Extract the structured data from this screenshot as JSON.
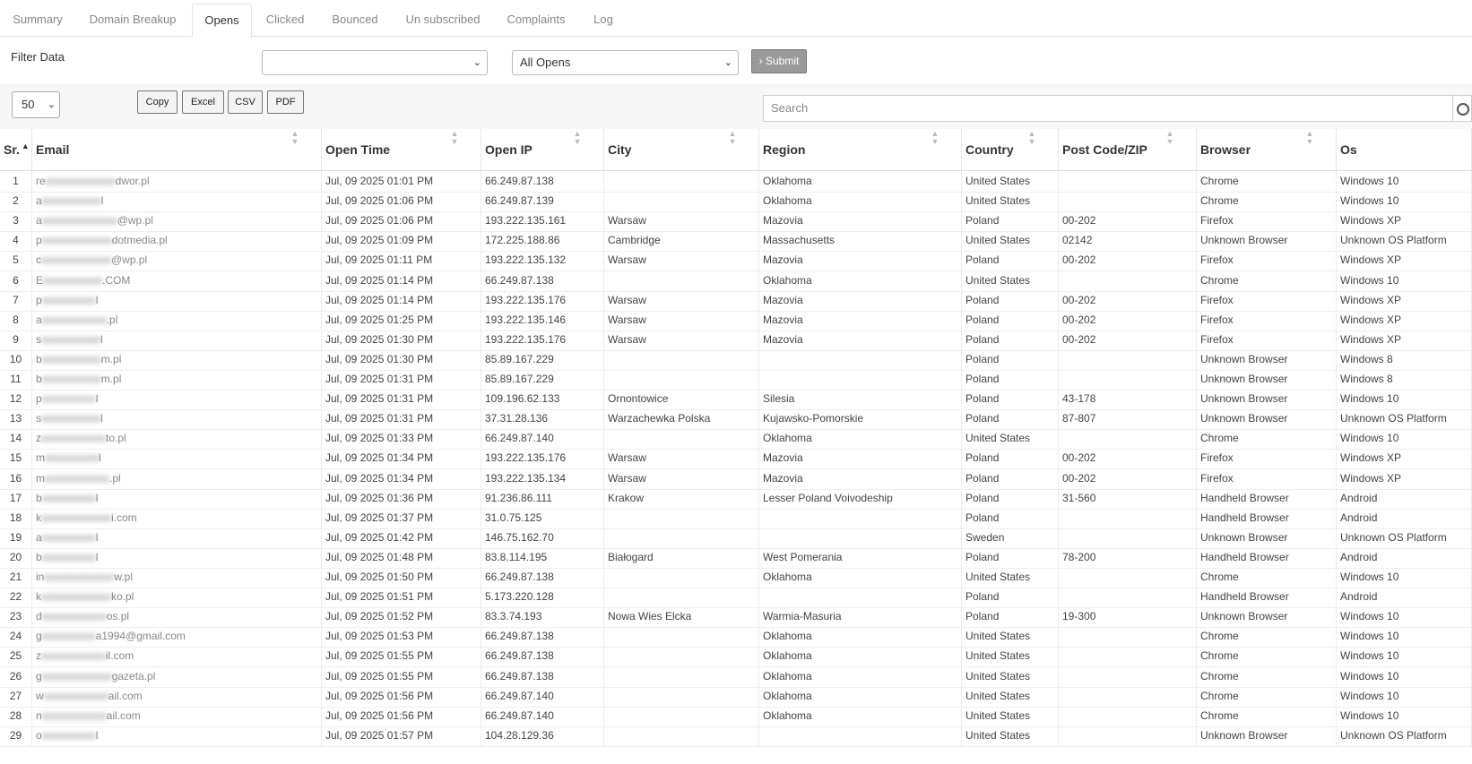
{
  "tabs": [
    {
      "label": "Summary",
      "active": false
    },
    {
      "label": "Domain Breakup",
      "active": false
    },
    {
      "label": "Opens",
      "active": true
    },
    {
      "label": "Clicked",
      "active": false
    },
    {
      "label": "Bounced",
      "active": false
    },
    {
      "label": "Un subscribed",
      "active": false
    },
    {
      "label": "Complaints",
      "active": false
    },
    {
      "label": "Log",
      "active": false
    }
  ],
  "filter": {
    "label": "Filter Data",
    "select1_value": "",
    "select2_value": "All Opens",
    "submit_label": "› Submit"
  },
  "controls": {
    "page_size": "50",
    "buttons": [
      "Copy",
      "Excel",
      "CSV",
      "PDF"
    ],
    "search_placeholder": "Search"
  },
  "columns": [
    "Sr.",
    "Email",
    "Open Time",
    "Open IP",
    "City",
    "Region",
    "Country",
    "Post Code/ZIP",
    "Browser",
    "Os"
  ],
  "rows": [
    [
      "1",
      "re■■■■■■■■■■■■■dwor.pl",
      "Jul, 09 2025 01:01 PM",
      "66.249.87.138",
      "",
      "Oklahoma",
      "United States",
      "",
      "Chrome",
      "Windows 10"
    ],
    [
      "2",
      "a■■■■■■■■■■■l",
      "Jul, 09 2025 01:06 PM",
      "66.249.87.139",
      "",
      "Oklahoma",
      "United States",
      "",
      "Chrome",
      "Windows 10"
    ],
    [
      "3",
      "a■■■■■■■■■■■■■■@wp.pl",
      "Jul, 09 2025 01:06 PM",
      "193.222.135.161",
      "Warsaw",
      "Mazovia",
      "Poland",
      "00-202",
      "Firefox",
      "Windows XP"
    ],
    [
      "4",
      "p■■■■■■■■■■■■■dotmedia.pl",
      "Jul, 09 2025 01:09 PM",
      "172.225.188.86",
      "Cambridge",
      "Massachusetts",
      "United States",
      "02142",
      "Unknown Browser",
      "Unknown OS Platform"
    ],
    [
      "5",
      "c■■■■■■■■■■■■■@wp.pl",
      "Jul, 09 2025 01:11 PM",
      "193.222.135.132",
      "Warsaw",
      "Mazovia",
      "Poland",
      "00-202",
      "Firefox",
      "Windows XP"
    ],
    [
      "6",
      "E■■■■■■■■■■■.COM",
      "Jul, 09 2025 01:14 PM",
      "66.249.87.138",
      "",
      "Oklahoma",
      "United States",
      "",
      "Chrome",
      "Windows 10"
    ],
    [
      "7",
      "p■■■■■■■■■■l",
      "Jul, 09 2025 01:14 PM",
      "193.222.135.176",
      "Warsaw",
      "Mazovia",
      "Poland",
      "00-202",
      "Firefox",
      "Windows XP"
    ],
    [
      "8",
      "a■■■■■■■■■■■■.pl",
      "Jul, 09 2025 01:25 PM",
      "193.222.135.146",
      "Warsaw",
      "Mazovia",
      "Poland",
      "00-202",
      "Firefox",
      "Windows XP"
    ],
    [
      "9",
      "s■■■■■■■■■■■l",
      "Jul, 09 2025 01:30 PM",
      "193.222.135.176",
      "Warsaw",
      "Mazovia",
      "Poland",
      "00-202",
      "Firefox",
      "Windows XP"
    ],
    [
      "10",
      "b■■■■■■■■■■■m.pl",
      "Jul, 09 2025 01:30 PM",
      "85.89.167.229",
      "",
      "",
      "Poland",
      "",
      "Unknown Browser",
      "Windows 8"
    ],
    [
      "11",
      "b■■■■■■■■■■■m.pl",
      "Jul, 09 2025 01:31 PM",
      "85.89.167.229",
      "",
      "",
      "Poland",
      "",
      "Unknown Browser",
      "Windows 8"
    ],
    [
      "12",
      "p■■■■■■■■■■l",
      "Jul, 09 2025 01:31 PM",
      "109.196.62.133",
      "Ornontowice",
      "Silesia",
      "Poland",
      "43-178",
      "Unknown Browser",
      "Windows 10"
    ],
    [
      "13",
      "s■■■■■■■■■■■l",
      "Jul, 09 2025 01:31 PM",
      "37.31.28.136",
      "Warzachewka Polska",
      "Kujawsko-Pomorskie",
      "Poland",
      "87-807",
      "Unknown Browser",
      "Unknown OS Platform"
    ],
    [
      "14",
      "z■■■■■■■■■■■■to.pl",
      "Jul, 09 2025 01:33 PM",
      "66.249.87.140",
      "",
      "Oklahoma",
      "United States",
      "",
      "Chrome",
      "Windows 10"
    ],
    [
      "15",
      "m■■■■■■■■■■l",
      "Jul, 09 2025 01:34 PM",
      "193.222.135.176",
      "Warsaw",
      "Mazovia",
      "Poland",
      "00-202",
      "Firefox",
      "Windows XP"
    ],
    [
      "16",
      "m■■■■■■■■■■■■.pl",
      "Jul, 09 2025 01:34 PM",
      "193.222.135.134",
      "Warsaw",
      "Mazovia",
      "Poland",
      "00-202",
      "Firefox",
      "Windows XP"
    ],
    [
      "17",
      "b■■■■■■■■■■l",
      "Jul, 09 2025 01:36 PM",
      "91.236.86.111",
      "Krakow",
      "Lesser Poland Voivodeship",
      "Poland",
      "31-560",
      "Handheld Browser",
      "Android"
    ],
    [
      "18",
      "k■■■■■■■■■■■■■i.com",
      "Jul, 09 2025 01:37 PM",
      "31.0.75.125",
      "",
      "",
      "Poland",
      "",
      "Handheld Browser",
      "Android"
    ],
    [
      "19",
      "a■■■■■■■■■■l",
      "Jul, 09 2025 01:42 PM",
      "146.75.162.70",
      "",
      "",
      "Sweden",
      "",
      "Unknown Browser",
      "Unknown OS Platform"
    ],
    [
      "20",
      "b■■■■■■■■■■l",
      "Jul, 09 2025 01:48 PM",
      "83.8.114.195",
      "Białogard",
      "West Pomerania",
      "Poland",
      "78-200",
      "Handheld Browser",
      "Android"
    ],
    [
      "21",
      "in■■■■■■■■■■■■■w.pl",
      "Jul, 09 2025 01:50 PM",
      "66.249.87.138",
      "",
      "Oklahoma",
      "United States",
      "",
      "Chrome",
      "Windows 10"
    ],
    [
      "22",
      "k■■■■■■■■■■■■■ko.pl",
      "Jul, 09 2025 01:51 PM",
      "5.173.220.128",
      "",
      "",
      "Poland",
      "",
      "Handheld Browser",
      "Android"
    ],
    [
      "23",
      "d■■■■■■■■■■■■os.pl",
      "Jul, 09 2025 01:52 PM",
      "83.3.74.193",
      "Nowa Wies Elcka",
      "Warmia-Masuria",
      "Poland",
      "19-300",
      "Unknown Browser",
      "Windows 10"
    ],
    [
      "24",
      "g■■■■■■■■■■a1994@gmail.com",
      "Jul, 09 2025 01:53 PM",
      "66.249.87.138",
      "",
      "Oklahoma",
      "United States",
      "",
      "Chrome",
      "Windows 10"
    ],
    [
      "25",
      "z■■■■■■■■■■■■il.com",
      "Jul, 09 2025 01:55 PM",
      "66.249.87.138",
      "",
      "Oklahoma",
      "United States",
      "",
      "Chrome",
      "Windows 10"
    ],
    [
      "26",
      "g■■■■■■■■■■■■■gazeta.pl",
      "Jul, 09 2025 01:55 PM",
      "66.249.87.138",
      "",
      "Oklahoma",
      "United States",
      "",
      "Chrome",
      "Windows 10"
    ],
    [
      "27",
      "w■■■■■■■■■■■■ail.com",
      "Jul, 09 2025 01:56 PM",
      "66.249.87.140",
      "",
      "Oklahoma",
      "United States",
      "",
      "Chrome",
      "Windows 10"
    ],
    [
      "28",
      "n■■■■■■■■■■■■ail.com",
      "Jul, 09 2025 01:56 PM",
      "66.249.87.140",
      "",
      "Oklahoma",
      "United States",
      "",
      "Chrome",
      "Windows 10"
    ],
    [
      "29",
      "o■■■■■■■■■■l",
      "Jul, 09 2025 01:57 PM",
      "104.28.129.36",
      "",
      "",
      "United States",
      "",
      "Unknown Browser",
      "Unknown OS Platform"
    ]
  ]
}
